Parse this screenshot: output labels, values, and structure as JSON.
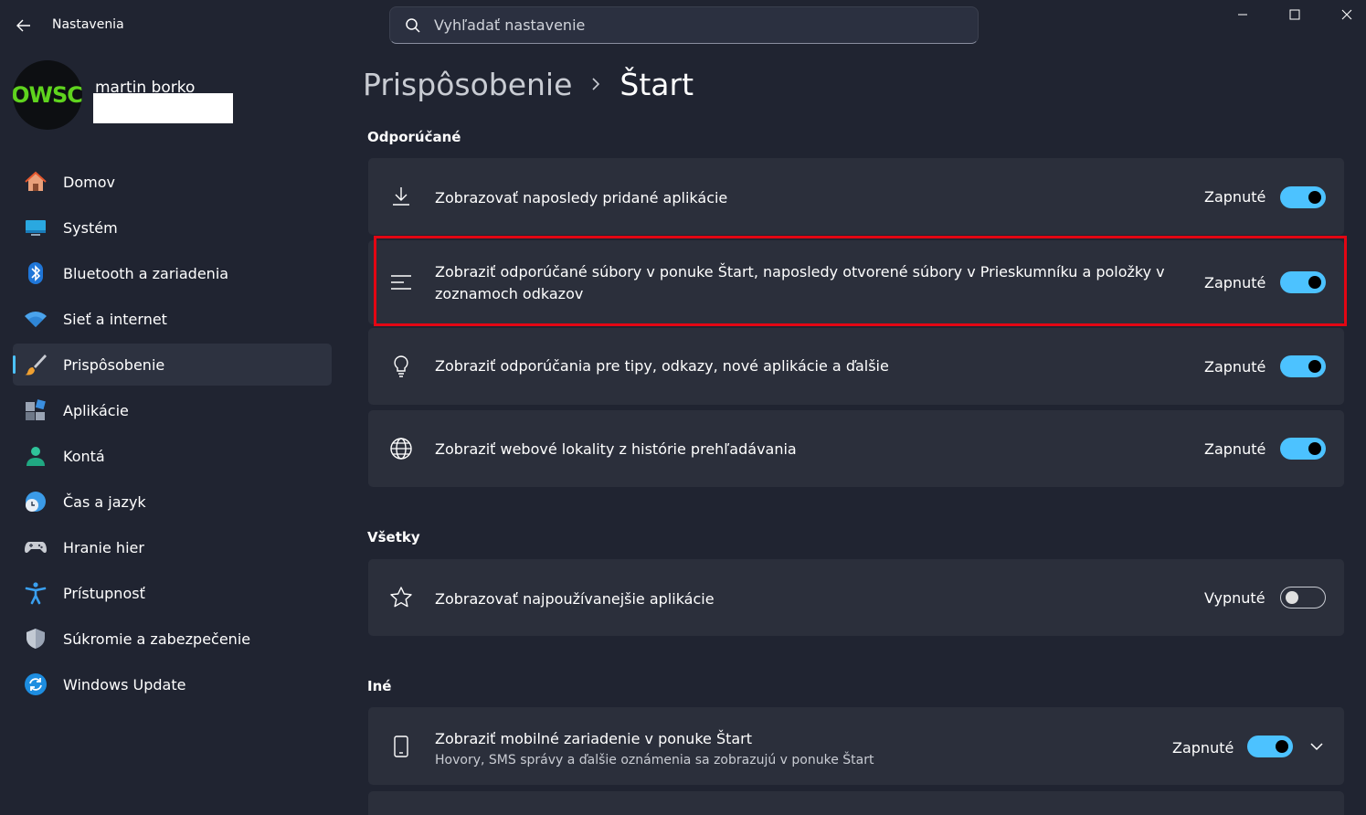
{
  "window": {
    "app_title": "Nastavenia",
    "search_placeholder": "Vyhľadať nastavenie"
  },
  "profile": {
    "avatar_text": "OWSC",
    "name": "martin borko"
  },
  "sidebar": {
    "items": [
      {
        "label": "Domov",
        "icon": "home-icon"
      },
      {
        "label": "Systém",
        "icon": "monitor-icon"
      },
      {
        "label": "Bluetooth a zariadenia",
        "icon": "bluetooth-icon"
      },
      {
        "label": "Sieť a internet",
        "icon": "wifi-icon"
      },
      {
        "label": "Prispôsobenie",
        "icon": "brush-icon",
        "active": true
      },
      {
        "label": "Aplikácie",
        "icon": "apps-icon"
      },
      {
        "label": "Kontá",
        "icon": "person-icon"
      },
      {
        "label": "Čas a jazyk",
        "icon": "globe-clock-icon"
      },
      {
        "label": "Hranie hier",
        "icon": "gamepad-icon"
      },
      {
        "label": "Prístupnosť",
        "icon": "accessibility-icon"
      },
      {
        "label": "Súkromie a zabezpečenie",
        "icon": "shield-icon"
      },
      {
        "label": "Windows Update",
        "icon": "update-icon"
      }
    ]
  },
  "breadcrumb": {
    "parent": "Prispôsobenie",
    "current": "Štart"
  },
  "sections": {
    "recommended": "Odporúčané",
    "all": "Všetky",
    "other": "Iné"
  },
  "settings": {
    "recent_apps": {
      "label": "Zobrazovať naposledy pridané aplikácie",
      "state": "Zapnuté",
      "on": true,
      "icon": "download-icon"
    },
    "recommended_files": {
      "label": "Zobraziť odporúčané súbory v ponuke Štart, naposledy otvorené súbory v Prieskumníku a položky v zoznamoch odkazov",
      "state": "Zapnuté",
      "on": true,
      "icon": "list-icon"
    },
    "tips": {
      "label": "Zobraziť odporúčania pre tipy, odkazy, nové aplikácie a ďalšie",
      "state": "Zapnuté",
      "on": true,
      "icon": "lightbulb-icon"
    },
    "websites": {
      "label": "Zobraziť webové lokality z histórie prehľadávania",
      "state": "Zapnuté",
      "on": true,
      "icon": "globe-icon"
    },
    "most_used": {
      "label": "Zobrazovať najpoužívanejšie aplikácie",
      "state": "Vypnuté",
      "on": false,
      "icon": "star-icon"
    },
    "mobile": {
      "label": "Zobraziť mobilné zariadenie v ponuke Štart",
      "sub": "Hovory, SMS správy a ďalšie oznámenia sa zobrazujú v ponuke Štart",
      "state": "Zapnuté",
      "on": true,
      "icon": "phone-icon"
    }
  },
  "colors": {
    "accent": "#4cc2ff",
    "highlight": "#e30613",
    "background": "#202431",
    "card": "#2b2f3b"
  }
}
